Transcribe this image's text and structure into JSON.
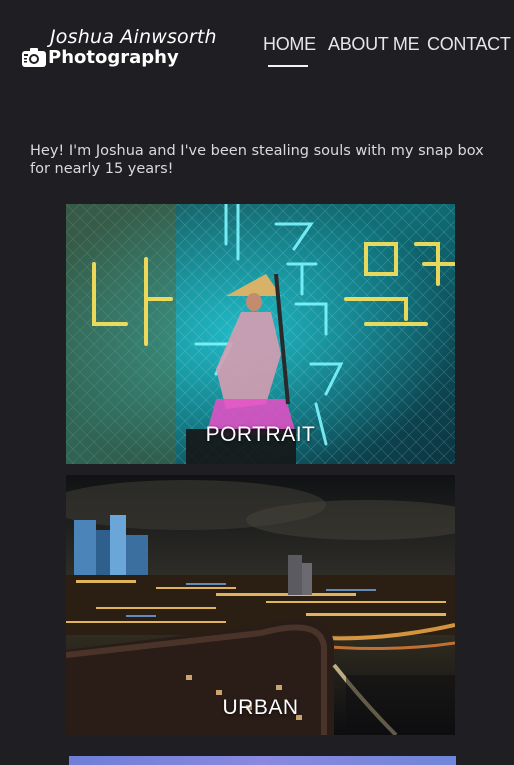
{
  "header": {
    "brand_name": "Joshua Ainwsorth",
    "brand_sub": "Photography",
    "logo_icon": "camera-icon"
  },
  "nav": {
    "items": [
      {
        "label": "HOME",
        "active": true
      },
      {
        "label": "ABOUT ME",
        "active": false
      },
      {
        "label": "CONTACT",
        "active": false
      }
    ]
  },
  "intro": {
    "text": "Hey! I'm Joshua and I've been stealing souls with my snap box for nearly 15 years!"
  },
  "gallery": {
    "cards": [
      {
        "label": "PORTRAIT"
      },
      {
        "label": "URBAN"
      }
    ]
  },
  "colors": {
    "background": "#1f1f23",
    "text": "#e6e6ea",
    "nav_underline": "#f2f2f4"
  }
}
